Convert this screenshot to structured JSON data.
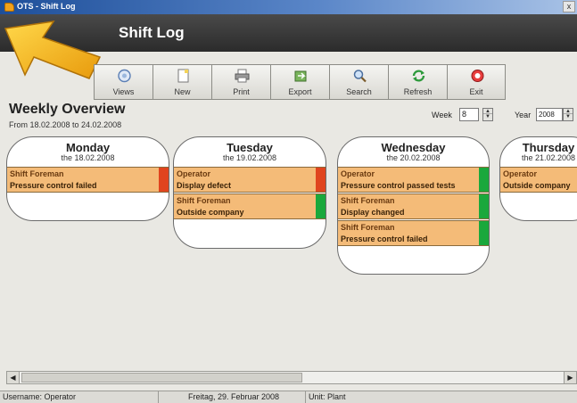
{
  "window": {
    "title": "OTS - Shift Log",
    "close_glyph": "x"
  },
  "header": {
    "title": "Shift Log"
  },
  "toolbar": {
    "buttons": [
      {
        "label": "Views",
        "icon": "views-icon"
      },
      {
        "label": "New",
        "icon": "new-document-icon"
      },
      {
        "label": "Print",
        "icon": "printer-icon"
      },
      {
        "label": "Export",
        "icon": "export-icon"
      },
      {
        "label": "Search",
        "icon": "search-icon"
      },
      {
        "label": "Refresh",
        "icon": "refresh-icon"
      },
      {
        "label": "Exit",
        "icon": "exit-icon"
      }
    ]
  },
  "overview": {
    "title": "Weekly Overview",
    "range": "From 18.02.2008 to 24.02.2008",
    "week_label": "Week",
    "week_value": "8",
    "year_label": "Year",
    "year_value": "2008"
  },
  "days": [
    {
      "name": "Monday",
      "date": "the 18.02.2008",
      "entries": [
        {
          "role": "Shift Foreman",
          "text": "Pressure control failed",
          "status": "red"
        }
      ]
    },
    {
      "name": "Tuesday",
      "date": "the 19.02.2008",
      "entries": [
        {
          "role": "Operator",
          "text": "Display defect",
          "status": "red"
        },
        {
          "role": "Shift Foreman",
          "text": "Outside company",
          "status": "green"
        }
      ]
    },
    {
      "name": "Wednesday",
      "date": "the 20.02.2008",
      "entries": [
        {
          "role": "Operator",
          "text": "Pressure control passed tests",
          "status": "green"
        },
        {
          "role": "Shift Foreman",
          "text": "Display changed",
          "status": "green"
        },
        {
          "role": "Shift Foreman",
          "text": "Pressure control failed",
          "status": "green"
        }
      ]
    },
    {
      "name": "Thursday",
      "date": "the 21.02.2008",
      "entries": [
        {
          "role": "Operator",
          "text": "Outside company",
          "status": "none"
        }
      ]
    }
  ],
  "status_colors": {
    "red": "#e0441e",
    "green": "#1aa83c",
    "none": "transparent"
  },
  "statusbar": {
    "user": "Username: Operator",
    "date": "Freitag, 29. Februar 2008",
    "unit": "Unit: Plant"
  }
}
